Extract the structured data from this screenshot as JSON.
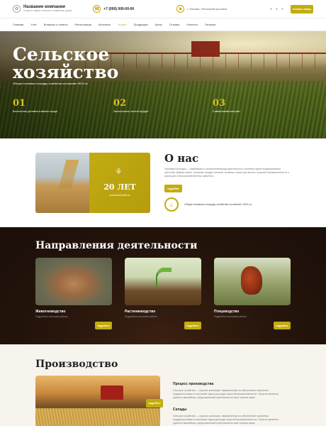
{
  "header": {
    "company_name": "Название компании",
    "company_tagline": "Услуги в сфере сельского хозяйства, рапса",
    "phone": "+7 (000) 000-00-00",
    "address": "г. Москва, Ленинский проспект",
    "cta": "оставить заявку"
  },
  "nav": [
    "Главная",
    "Учет",
    "Вопросы и ответы",
    "Регистрация",
    "Контакты",
    "Услуги",
    "Продукция",
    "Цены",
    "Отзывы",
    "Новости",
    "Галерея"
  ],
  "nav_active_index": 5,
  "hero": {
    "title_line1": "Сельское",
    "title_line2": "хозяйство",
    "subtitle": "Общая посевная площадь хозяйства составляет 9024 га",
    "stats": [
      {
        "num": "01",
        "text": "Бесплатная доставка в вашем городе"
      },
      {
        "num": "02",
        "text": "Экологически чистый продукт"
      },
      {
        "num": "03",
        "text": "Совместимый контракт"
      }
    ]
  },
  "about": {
    "years_value": "20 ЛЕТ",
    "years_sub": "успешной работы",
    "title": "О нас",
    "text": "Зерновые культуры — важнейшая и основополагающая деятельность основная группа возделываемых растений. Давшие зерно, основные продукт питания человека, сырье для многих отраслей промышленности и корма для сельскохозяйственных животных.",
    "button": "подробнее",
    "badge_text": "Общая посевная площадь хозяйства составляет 9024 га"
  },
  "directions": {
    "title": "Направления деятельности",
    "cards": [
      {
        "title": "Животноводство",
        "subtitle": "Подробное описание работы",
        "button": "подробнее"
      },
      {
        "title": "Растениеводство",
        "subtitle": "Подробное описание работы",
        "button": "подробнее"
      },
      {
        "title": "Птицеводство",
        "subtitle": "Подробное описание работы",
        "button": "подробнее"
      }
    ]
  },
  "production": {
    "title": "Производство",
    "image_button": "подробнее",
    "items": [
      {
        "heading": "Процесс производства",
        "text": "Сельское хозяйство — отрасль экономики, направленная на обеспечение населения продовольствием и получение сырья для ряда отраслей промышленности. Отрасль является одной из важнейших, представленной практически во всех странах мира."
      },
      {
        "heading": "Склады",
        "text": "Сельское хозяйство — отрасль экономики, направленная на обеспечение населения продовольствием и получение сырья для ряда отраслей промышленности. Отрасль является одной из важнейших, представленной практически во всех странах мира."
      }
    ]
  },
  "colors": {
    "accent": "#c2ad0e",
    "dark_bg": "#24140b",
    "light_bg": "#f7f4ee"
  },
  "icons": {
    "logo": "leaf-icon",
    "phone": "phone-icon",
    "location": "location-icon",
    "about_badge": "building-icon",
    "wheat": "wheat-icon"
  }
}
